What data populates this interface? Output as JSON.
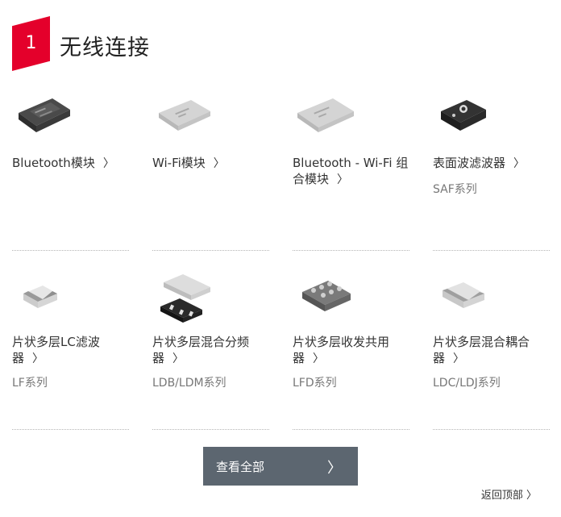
{
  "header": {
    "number": "1",
    "title": "无线连接"
  },
  "row1": [
    {
      "name": "Bluetooth模块",
      "series": "",
      "icon": "bluetooth-module-icon"
    },
    {
      "name": "Wi-Fi模块",
      "series": "",
      "icon": "wifi-module-icon"
    },
    {
      "name": "Bluetooth - Wi-Fi 组合模块",
      "series": "",
      "icon": "combo-module-icon"
    },
    {
      "name": "表面波滤波器",
      "series": "SAF系列",
      "icon": "saw-filter-icon"
    }
  ],
  "row2": [
    {
      "name": "片状多层LC滤波器",
      "series": "LF系列",
      "icon": "lc-filter-icon"
    },
    {
      "name": "片状多层混合分频器",
      "series": "LDB/LDM系列",
      "icon": "diplexer-icon"
    },
    {
      "name": "片状多层收发共用器",
      "series": "LFD系列",
      "icon": "duplexer-icon"
    },
    {
      "name": "片状多层混合耦合器",
      "series": "LDC/LDJ系列",
      "icon": "coupler-icon"
    }
  ],
  "chevron": "〉",
  "view_all": {
    "label": "查看全部",
    "arrow": "〉"
  },
  "back_to_top": "返回顶部 〉",
  "colors": {
    "accent": "#e4002b",
    "button": "#5c6670"
  }
}
